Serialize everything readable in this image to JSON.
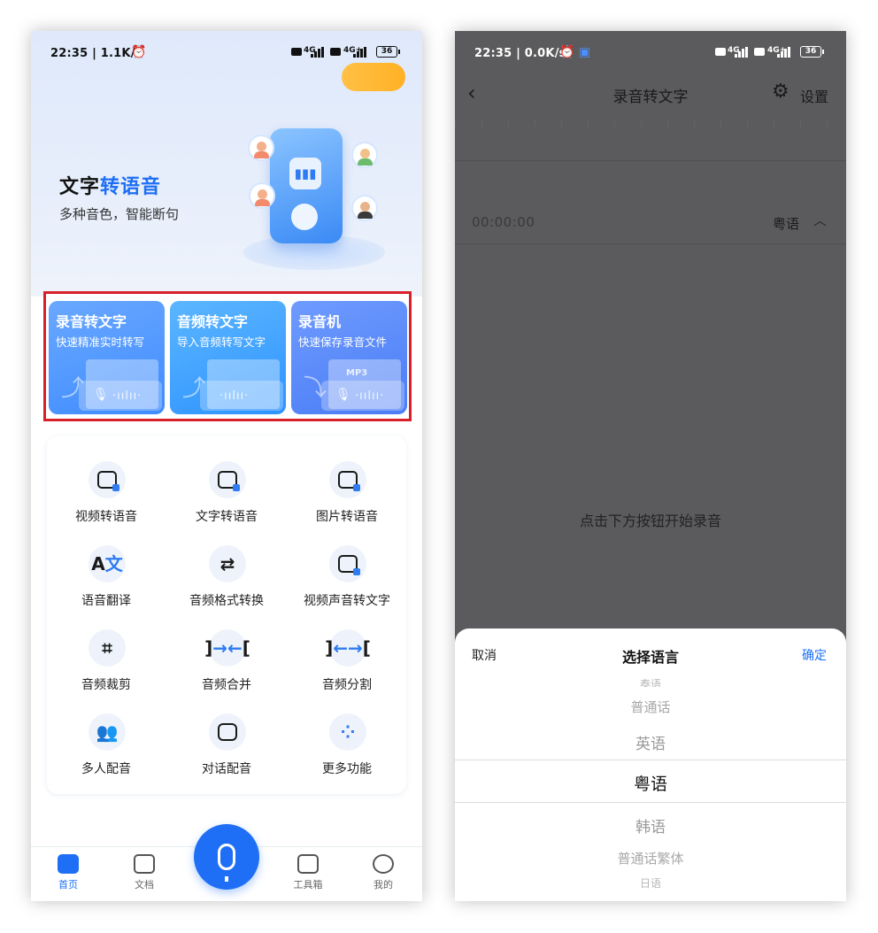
{
  "left": {
    "status": {
      "time": "22:35",
      "speed": "1.1K/s",
      "battery": "36"
    },
    "hero": {
      "title_plain": "文字",
      "title_accent": "转语音",
      "subtitle": "多种音色，智能断句"
    },
    "features": [
      {
        "title": "录音转文字",
        "sub": "快速精准实时转写",
        "color_a": "#3f8cff",
        "color_b": "#6aa8ff"
      },
      {
        "title": "音频转文字",
        "sub": "导入音频转写文字",
        "color_a": "#2e93ff",
        "color_b": "#5cb6ff"
      },
      {
        "title": "录音机",
        "sub": "快速保存录音文件",
        "color_a": "#4a7df5",
        "color_b": "#6f9bff"
      }
    ],
    "mp3_label": "MP3",
    "tools": [
      {
        "label": "视频转语音",
        "icon": "video-play-icon"
      },
      {
        "label": "文字转语音",
        "icon": "text-icon"
      },
      {
        "label": "图片转语音",
        "icon": "image-icon"
      },
      {
        "label": "语音翻译",
        "icon": "translate-icon"
      },
      {
        "label": "音频格式转换",
        "icon": "convert-icon"
      },
      {
        "label": "视频声音转文字",
        "icon": "video-text-icon"
      },
      {
        "label": "音频裁剪",
        "icon": "crop-icon"
      },
      {
        "label": "音频合并",
        "icon": "merge-icon"
      },
      {
        "label": "音频分割",
        "icon": "split-icon"
      },
      {
        "label": "多人配音",
        "icon": "people-icon"
      },
      {
        "label": "对话配音",
        "icon": "chat-icon"
      },
      {
        "label": "更多功能",
        "icon": "more-icon"
      }
    ],
    "tabs": {
      "home": "首页",
      "docs": "文档",
      "toolbox": "工具箱",
      "mine": "我的"
    },
    "accent": "#1e6ff5"
  },
  "right": {
    "status": {
      "time": "22:35",
      "speed": "0.0K/s",
      "battery": "36"
    },
    "nav": {
      "title": "录音转文字",
      "settings": "设置"
    },
    "timer": "00:00:00",
    "language": "粤语",
    "hint": "点击下方按钮开始录音",
    "sheet": {
      "cancel": "取消",
      "title": "选择语言",
      "confirm": "确定",
      "options": [
        "泰语",
        "普通话",
        "英语",
        "粤语",
        "韩语",
        "普通话繁体",
        "日语"
      ],
      "selected": "粤语"
    }
  }
}
